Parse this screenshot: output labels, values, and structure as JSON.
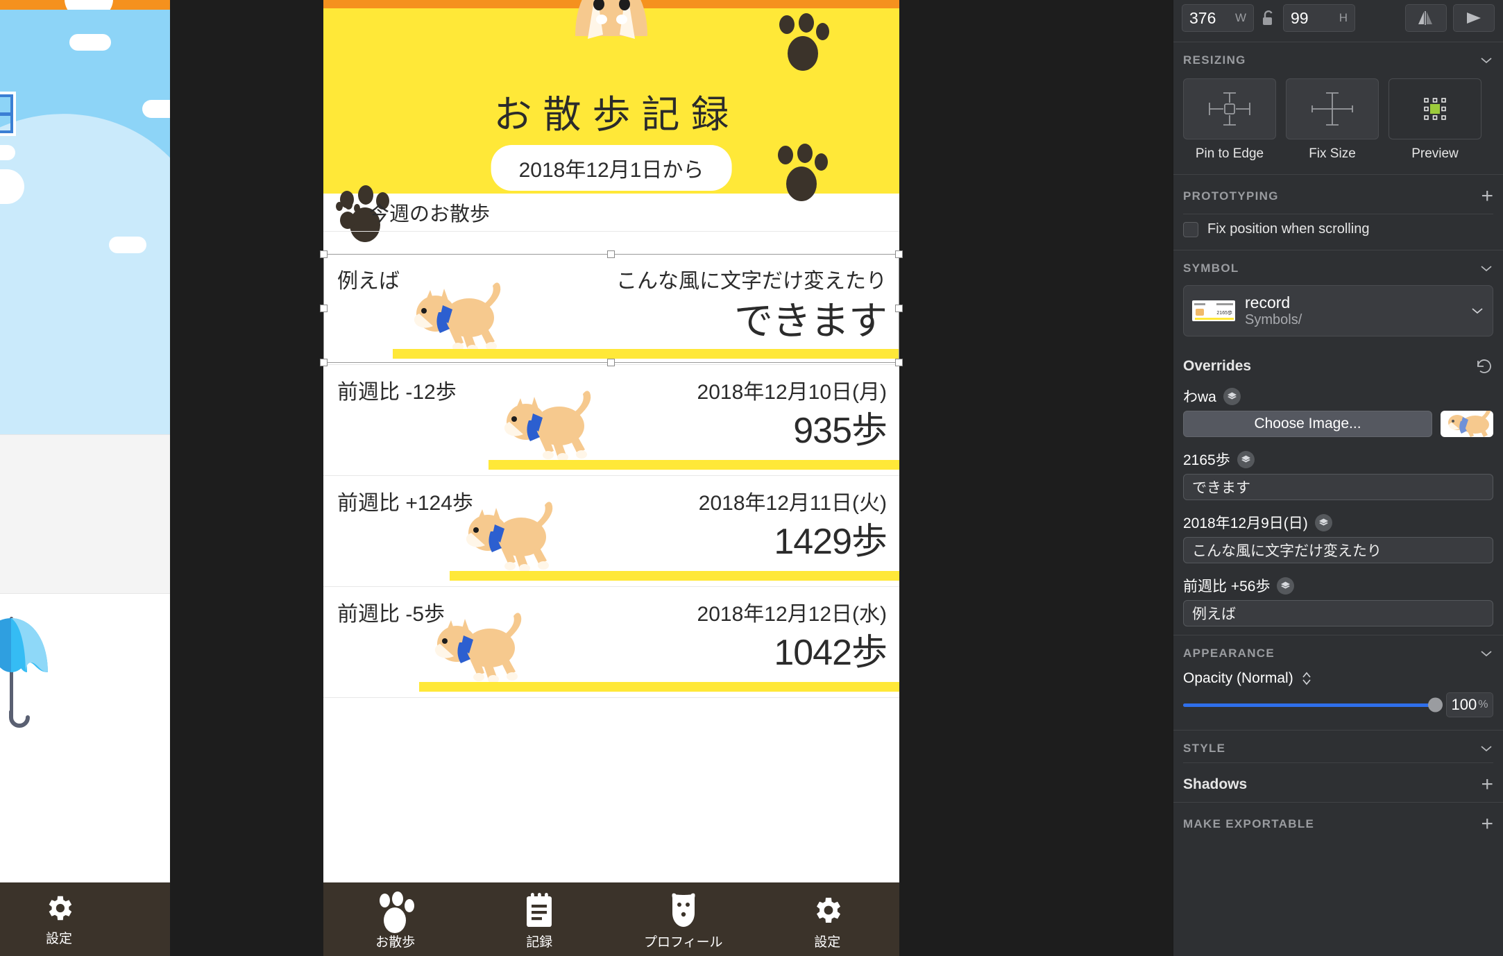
{
  "inspector": {
    "size": {
      "width_value": "376",
      "width_unit": "W",
      "height_value": "99",
      "height_unit": "H",
      "lock_icon": "unlock-icon",
      "flip_horizontal_icon": "flip-horizontal-icon",
      "flip_vertical_icon": "flip-vertical-icon"
    },
    "resizing": {
      "title": "RESIZING",
      "options": [
        {
          "label": "Pin to Edge",
          "icon": "pin-to-edge-icon"
        },
        {
          "label": "Fix Size",
          "icon": "fix-size-icon"
        },
        {
          "label": "Preview",
          "icon": "preview-icon"
        }
      ]
    },
    "prototyping": {
      "title": "PROTOTYPING",
      "add_icon": "plus-icon",
      "fix_position_label": "Fix position when scrolling",
      "fix_position_checked": false
    },
    "symbol": {
      "title": "SYMBOL",
      "name": "record",
      "path": "Symbols/",
      "thumbnail_icon": "symbol-thumbnail"
    },
    "overrides": {
      "title": "Overrides",
      "reset_icon": "reset-icon",
      "items": [
        {
          "label": "わwa",
          "layer_icon": "layers-icon",
          "type": "image",
          "button_label": "Choose Image...",
          "thumbnail_icon": "dog-image-thumbnail"
        },
        {
          "label": "2165歩",
          "layer_icon": "layers-icon",
          "type": "text",
          "value": "できます"
        },
        {
          "label": "2018年12月9日(日)",
          "layer_icon": "layers-icon",
          "type": "text",
          "value": "こんな風に文字だけ変えたり"
        },
        {
          "label": "前週比 +56歩",
          "layer_icon": "layers-icon",
          "type": "text",
          "value": "例えば"
        }
      ]
    },
    "appearance": {
      "title": "APPEARANCE",
      "opacity_label": "Opacity (Normal)",
      "opacity_value": "100",
      "opacity_unit": "%",
      "stepper_icon": "stepper-icon"
    },
    "style": {
      "title": "STYLE",
      "shadows_label": "Shadows",
      "shadows_add_icon": "plus-icon"
    },
    "make_exportable": {
      "title": "MAKE EXPORTABLE",
      "add_icon": "plus-icon"
    }
  },
  "canvas": {
    "artboard_left": {
      "tab_label": "設定",
      "tab_icon": "gear-icon",
      "umbrella_icon": "umbrella-icon"
    },
    "artboard_main": {
      "status_dot_icon": "status-dot-icon",
      "hero": {
        "title": "お散歩記録",
        "pill": "2018年12月1日から",
        "dog_head_icon": "shiba-head-icon",
        "paw_icon": "paw-icon"
      },
      "section_header": {
        "icon": "paw-icon",
        "label": "今週のお散歩"
      },
      "rows": [
        {
          "delta": "例えば",
          "date": "こんな風に文字だけ変えたり",
          "steps": "できます",
          "dog_icon": "shiba-walking-icon",
          "selected": true
        },
        {
          "delta": "前週比 -12歩",
          "date": "2018年12月10日(月)",
          "steps": "935歩",
          "dog_icon": "shiba-walking-icon",
          "selected": false
        },
        {
          "delta": "前週比 +124歩",
          "date": "2018年12月11日(火)",
          "steps": "1429歩",
          "dog_icon": "shiba-walking-icon",
          "selected": false
        },
        {
          "delta": "前週比 -5歩",
          "date": "2018年12月12日(水)",
          "steps": "1042歩",
          "dog_icon": "shiba-walking-icon",
          "selected": false
        }
      ],
      "tabs": [
        {
          "label": "お散歩",
          "icon": "paw-icon"
        },
        {
          "label": "記録",
          "icon": "clipboard-icon"
        },
        {
          "label": "プロフィール",
          "icon": "dog-face-icon"
        },
        {
          "label": "設定",
          "icon": "gear-icon"
        }
      ]
    }
  },
  "colors": {
    "panel_bg": "#2E3033",
    "accent_blue": "#2F6FEB",
    "brand_yellow": "#FFE838",
    "brand_orange": "#F5911E",
    "tabbar_brown": "#3B332A"
  }
}
